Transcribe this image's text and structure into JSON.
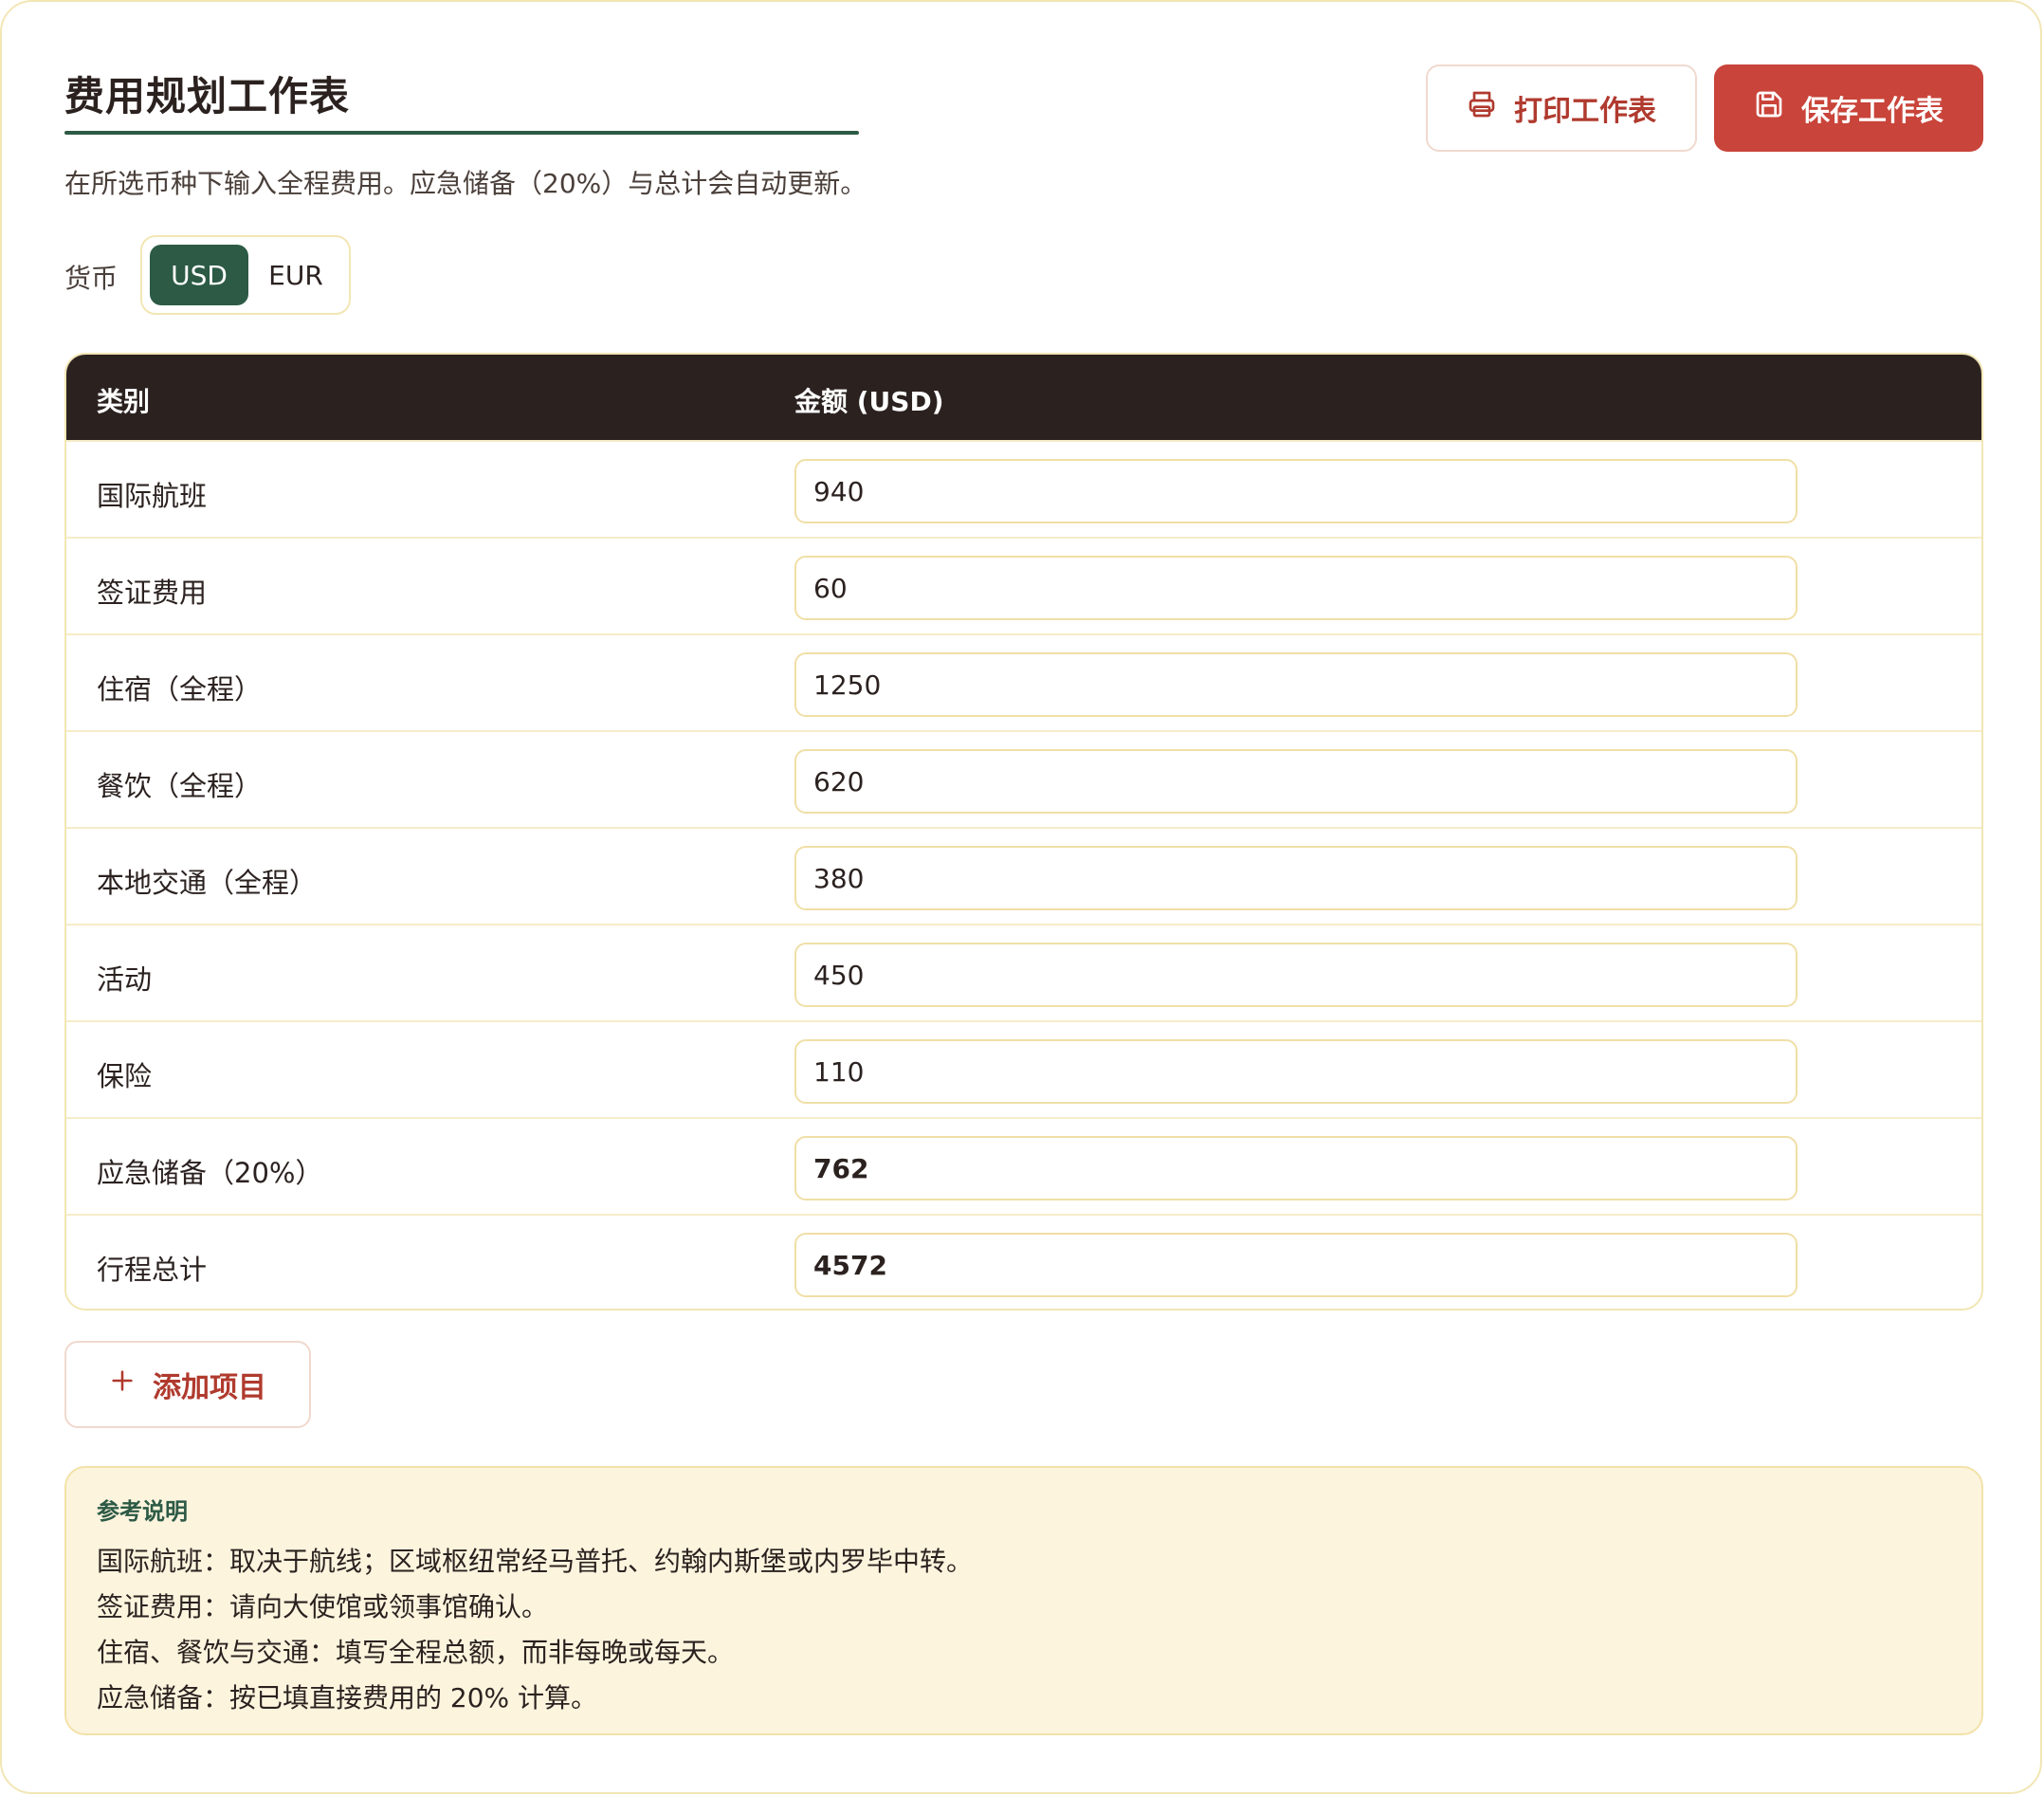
{
  "header": {
    "title": "费用规划工作表",
    "subtitle": "在所选币种下输入全程费用。应急储备（20%）与总计会自动更新。",
    "print_label": "打印工作表",
    "save_label": "保存工作表"
  },
  "currency": {
    "label": "货币",
    "options": [
      "USD",
      "EUR"
    ],
    "selected": "USD"
  },
  "table": {
    "col_category": "类别",
    "col_amount": "金额 (USD)",
    "rows": [
      {
        "label": "国际航班",
        "value": "940"
      },
      {
        "label": "签证费用",
        "value": "60"
      },
      {
        "label": "住宿（全程）",
        "value": "1250"
      },
      {
        "label": "餐饮（全程）",
        "value": "620"
      },
      {
        "label": "本地交通（全程）",
        "value": "380"
      },
      {
        "label": "活动",
        "value": "450"
      },
      {
        "label": "保险",
        "value": "110"
      },
      {
        "label": "应急储备（20%）",
        "value": "762"
      },
      {
        "label": "行程总计",
        "value": "4572"
      }
    ]
  },
  "add_item_label": "添加项目",
  "notes": {
    "title": "参考说明",
    "lines": [
      "国际航班：取决于航线；区域枢纽常经马普托、约翰内斯堡或内罗毕中转。",
      "签证费用：请向大使馆或领事馆确认。",
      "住宿、餐饮与交通：填写全程总额，而非每晚或每天。",
      "应急储备：按已填直接费用的 20% 计算。"
    ]
  },
  "colors": {
    "accent_green": "#2c5a45",
    "accent_red": "#c9443a",
    "header_dark": "#2b2220",
    "notes_bg": "#fdf4de"
  }
}
